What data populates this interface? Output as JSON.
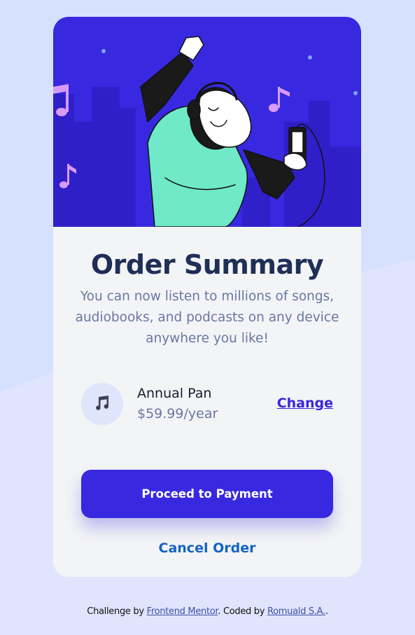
{
  "hero": {
    "illustration": "person-dancing-with-headphones-illustration"
  },
  "summary": {
    "title": "Order Summary",
    "description": "You can now listen to millions of songs, audiobooks, and podcasts on any device anywhere you like!"
  },
  "plan": {
    "icon": "music-note-icon",
    "name": "Annual Pan",
    "price": "$59.99/year",
    "change_label": "Change"
  },
  "actions": {
    "proceed_label": "Proceed to Payment",
    "cancel_label": "Cancel Order"
  },
  "attribution": {
    "prefix": "Challenge by ",
    "link1": "Frontend Mentor",
    "middle": ". Coded by ",
    "link2": "Romuald S.A.",
    "suffix": "."
  },
  "colors": {
    "page_background": "#e1e4fd",
    "wave": "#d6e1ff",
    "hero_background": "#3829e0",
    "card_background": "#f3f4f6",
    "title": "#1f2f56",
    "accent": "#3828e0",
    "cancel": "#1463c4"
  }
}
